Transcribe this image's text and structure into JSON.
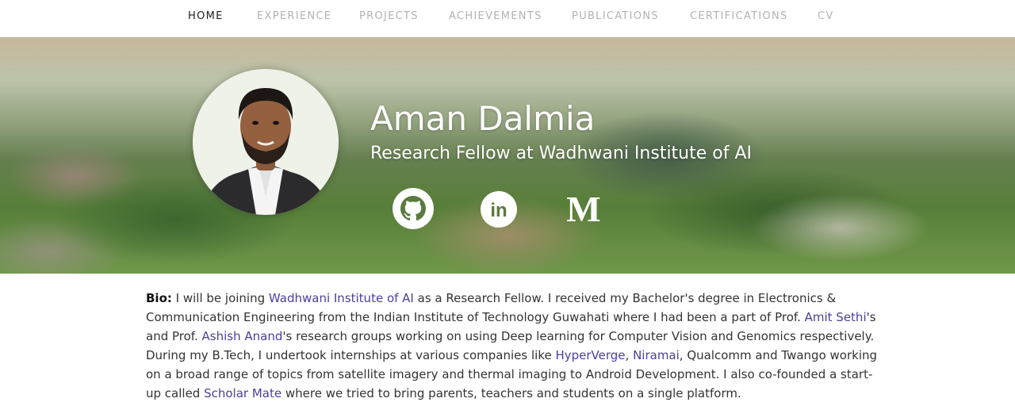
{
  "nav": {
    "items": [
      {
        "label": "HOME",
        "active": true
      },
      {
        "label": "EXPERIENCE"
      },
      {
        "label": "PROJECTS"
      },
      {
        "label": "ACHIEVEMENTS"
      },
      {
        "label": "PUBLICATIONS"
      },
      {
        "label": "CERTIFICATIONS"
      },
      {
        "label": "CV"
      }
    ]
  },
  "hero": {
    "name": "Aman Dalmia",
    "role": "Research Fellow at Wadhwani Institute of AI",
    "social": [
      {
        "icon": "github-icon"
      },
      {
        "icon": "linkedin-icon",
        "text": "in"
      },
      {
        "icon": "medium-icon",
        "text": "M"
      }
    ]
  },
  "bio": {
    "label": "Bio:",
    "t1": " I will be joining ",
    "link1": "Wadhwani Institute of AI",
    "t2": " as a Research Fellow. I received my Bachelor's degree in Electronics & Communication Engineering from the Indian Institute of Technology Guwahati where I had been a part of Prof. ",
    "link2": "Amit Sethi",
    "t3": "'s and Prof. ",
    "link3": "Ashish Anand",
    "t4": "'s research groups working on using Deep learning for Computer Vision and Genomics respectively. During my B.Tech, I undertook internships at various companies like ",
    "link4": "HyperVerge",
    "t5": ", ",
    "link5": "Niramai",
    "t6": ", Qualcomm and Twango working on a broad range of topics from satellite imagery and thermal imaging to Android Development. I also co-founded a start-up called ",
    "link6": "Scholar Mate",
    "t7": " where we tried to bring parents, teachers and students on a single platform."
  },
  "colors": {
    "link": "#4c3f9c",
    "nav_active": "#222222",
    "nav_inactive": "#b3b3b3"
  }
}
